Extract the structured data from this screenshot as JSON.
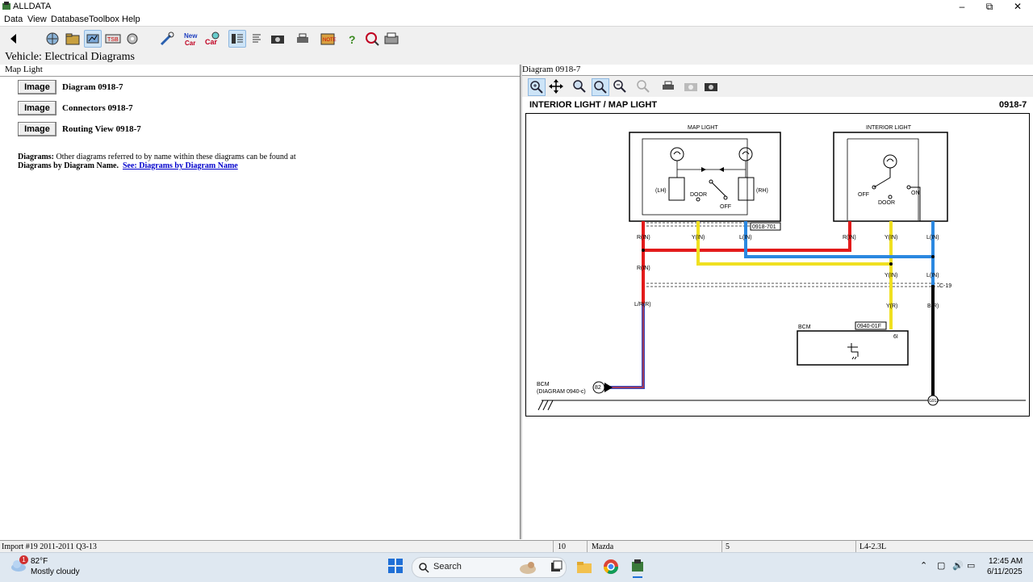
{
  "window": {
    "title": "ALLDATA",
    "minimize_icon": "minimize-icon",
    "maximize_icon": "restore-icon",
    "close_icon": "close-icon"
  },
  "menu": [
    "Data",
    "View",
    "Database",
    "Toolbox",
    "Help"
  ],
  "header": {
    "title": "Vehicle:  Electrical Diagrams"
  },
  "left": {
    "caption": "Map Light",
    "items": [
      {
        "button": "Image",
        "label": "Diagram 0918-7"
      },
      {
        "button": "Image",
        "label": "Connectors 0918-7"
      },
      {
        "button": "Image",
        "label": "Routing View 0918-7"
      }
    ],
    "note_bold": "Diagrams:",
    "note_text1": " Other diagrams referred to by name within these diagrams can be found at",
    "note_text2": "Diagrams by Diagram Name.",
    "note_link": "See: Diagrams by Diagram Name"
  },
  "right": {
    "caption": "Diagram 0918-7",
    "diagram_title": "INTERIOR LIGHT / MAP LIGHT",
    "diagram_number": "0918-7",
    "labels": {
      "map_light": "MAP LIGHT",
      "interior_light": "INTERIOR LIGHT",
      "lh": "(LH)",
      "rh": "(RH)",
      "door": "DOOR",
      "off": "OFF",
      "on": "ON",
      "door2": "DOOR",
      "off2": "OFF",
      "conn1": "0918-701",
      "r_in": "R(IN)",
      "y_in": "Y(IN)",
      "l_in": "L(IN)",
      "r_in2": "R(IN)",
      "y_in2": "Y(IN)",
      "l_in2": "L(IN)",
      "r_in3": "R(IN)",
      "y_in3": "Y(IN)",
      "l_in3": "L(IN)",
      "c19": "C-19",
      "lr_r": "L/R(R)",
      "y_r": "Y(R)",
      "b_r": "B(R)",
      "bcm": "BCM",
      "bcm_conn": "0940-01F",
      "pin6i": "6I",
      "bcm_ref1": "BCM",
      "bcm_ref2": "(DIAGRAM  0940-c)",
      "pin82": "82",
      "g912": "G912"
    }
  },
  "status": {
    "import": "Import #19 2011-2011 Q3-13",
    "num": "10",
    "make": "Mazda",
    "num2": "5",
    "engine": "L4-2.3L"
  },
  "taskbar": {
    "weather_temp": "82°F",
    "weather_desc": "Mostly cloudy",
    "weather_badge": "1",
    "search_placeholder": "Search",
    "time": "12:45 AM",
    "date": "6/11/2025"
  }
}
